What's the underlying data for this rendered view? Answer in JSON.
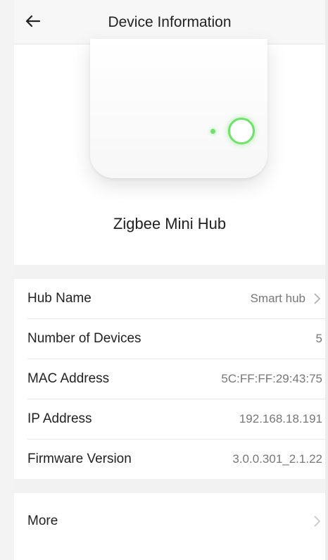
{
  "header": {
    "title": "Device Information",
    "back_icon": "arrow-left-icon"
  },
  "device": {
    "name": "Zigbee Mini Hub",
    "indicator_color": "#6fe26a"
  },
  "info": {
    "hub_name": {
      "label": "Hub Name",
      "value": "Smart hub"
    },
    "devices": {
      "label": "Number of Devices",
      "value": "5"
    },
    "mac": {
      "label": "MAC Address",
      "value": "5C:FF:FF:29:43:75"
    },
    "ip": {
      "label": "IP Address",
      "value": "192.168.18.191"
    },
    "firmware": {
      "label": "Firmware Version",
      "value": "3.0.0.301_2.1.22"
    }
  },
  "more": {
    "label": "More"
  }
}
